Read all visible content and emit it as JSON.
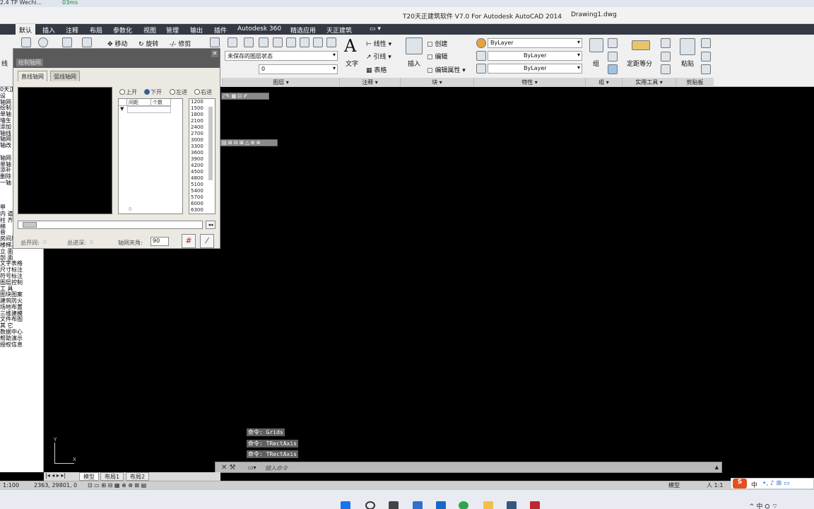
{
  "browser_tab": {
    "text": "2.4 TP Wechi...",
    "badge": "03ms"
  },
  "window": {
    "title": "T20天正建筑软件 V7.0 For Autodesk AutoCAD 2014",
    "document": "Drawing1.dwg"
  },
  "ribbon_tabs": [
    "默认",
    "插入",
    "注释",
    "布局",
    "参数化",
    "视图",
    "管理",
    "输出",
    "插件",
    "Autodesk 360",
    "精选应用",
    "天正建筑"
  ],
  "ribbon": {
    "draw": {
      "line": "线"
    },
    "modify": {
      "move": "移动",
      "rotate": "旋转",
      "trim": "修剪"
    },
    "layers": {
      "state": "未保存的图层状态",
      "current": "0",
      "panel": "图层 ▾"
    },
    "annotation": {
      "text": "文字",
      "linear": "线性",
      "leader": "引线",
      "table": "表格",
      "panel": "注释 ▾"
    },
    "block": {
      "insert": "插入",
      "create": "创建",
      "edit": "编辑",
      "edit_attr": "编辑属性",
      "panel": "块 ▾"
    },
    "properties": {
      "color": "ByLayer",
      "linetype": "ByLayer",
      "lineweight": "ByLayer",
      "panel": "特性 ▾"
    },
    "group": {
      "label": "组",
      "panel": "组 ▾"
    },
    "utilities": {
      "measure": "定距等分",
      "panel": "实用工具 ▾"
    },
    "clipboard": {
      "paste": "粘贴",
      "panel": "剪贴板"
    }
  },
  "left_menu": [
    "0天正",
    "设",
    "轴网",
    "绘制",
    "单轴",
    "墙生",
    "添加",
    "轴线",
    "轴网",
    "轴改",
    "",
    "轴网",
    "单轴",
    "添补",
    "删除",
    "一轴",
    "",
    "",
    "",
    "甲",
    "内 道",
    "柱 齐",
    "梯",
    "音",
    "房间屋顶",
    "楼梯其他",
    "立 面",
    "剖 面",
    "文字表格",
    "尺寸标注",
    "符号标注",
    "图层控制",
    "工 具",
    "图块图案",
    "建筑防火",
    "场地布置",
    "三维建模",
    "文件布图",
    "其 它",
    "数据中心",
    "帮助演示",
    "授权信息"
  ],
  "dialog": {
    "title": "绘制轴网",
    "tab_straight": "直线轴网",
    "tab_arc": "弧线轴网",
    "radio": [
      "上开",
      "下开",
      "左进",
      "右进"
    ],
    "col_spacing": "间距",
    "col_count": "个数",
    "zero": "0",
    "values": [
      "1200",
      "1500",
      "1800",
      "2100",
      "2400",
      "2700",
      "3000",
      "3300",
      "3600",
      "3900",
      "4200",
      "4500",
      "4800",
      "5100",
      "5400",
      "5700",
      "6000",
      "6300"
    ],
    "total_open": "总开间:",
    "total_open_val": "0",
    "total_depth": "总进深:",
    "total_depth_val": "0",
    "angle_label": "轴网夹角:",
    "angle_value": "90"
  },
  "command_history": [
    "命令: Grids",
    "命令: TRectAxis",
    "命令: TRectAxis"
  ],
  "command_placeholder": "键入命令",
  "ucs": {
    "x": "X",
    "y": "Y"
  },
  "layout_tabs": [
    "模型",
    "布局1",
    "布局2"
  ],
  "status": {
    "scale": "1:100",
    "coords": "2363,  29801,  0",
    "model": "模型",
    "anno": "人 1:1"
  },
  "ime": {
    "lang": "中"
  }
}
